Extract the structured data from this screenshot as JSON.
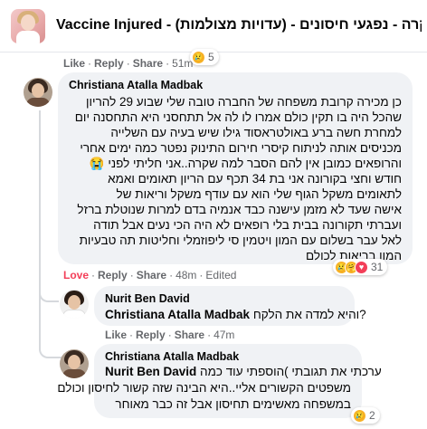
{
  "group": {
    "title": "Vaccine Injured - (עדויות מצולמות) - גם לנו זה קרה - נפגעי חיסונים"
  },
  "top_actions": {
    "like": "Like",
    "reply": "Reply",
    "share": "Share",
    "time": "51m",
    "reaction_count": "5"
  },
  "comments": [
    {
      "author": "Christiana Atalla Madbak",
      "lines": [
        "כן מכירה קרובת משפחה של החברה טובה שלי שבוע 29 להריון",
        "שהכל היה בו תקין כולם אמרו לו לה אל תתחסני היא התחסנה יום",
        "למחרת חשה ברע באולטראסוד גילו שיש בעיה עם השלייה",
        "מכניסים אותה לניתוח קיסרי חירום התינוק נפטר כמה ימים אחרי",
        "והרופאים כמובן אין להם הסבר למה שקרה..אני חליתי לפני 😭",
        "חודש וחצי בקורונה אני בת 34 תכף עם הריון תאומים ואמא",
        "לתאומים משקל הגוף שלי הוא עם עודף משקל וריאות של",
        "אישה שעד לא מזמן עישנה כבד אנמיה בדם למרות שנוטלת ברזל",
        "ועברתי תקורונה בבית בלי רופאים לא היה הכי נעים אבל תודה",
        "לאל עבר בשלום עם המון ויטמין סי ליפוזמלי וחליטות תה טבעיות",
        "המון בריאות לכולם"
      ],
      "actions": {
        "love": "Love",
        "reply": "Reply",
        "share": "Share",
        "time": "48m",
        "edited": "Edited"
      },
      "reaction_count": "31"
    },
    {
      "author": "Nurit Ben David",
      "tag": "Christiana Atalla Madbak",
      "text": "והיא למדה את הלקח?",
      "actions": {
        "like": "Like",
        "reply": "Reply",
        "share": "Share",
        "time": "47m"
      }
    },
    {
      "author": "Christiana Atalla Madbak",
      "tag": "Nurit Ben David",
      "first_line": "ערכתי את תגובתי )הוספתי עוד כמה",
      "lines": [
        "משפטים הקשורים אליי..היא הבינה שזה קשור לחיסון וכולם",
        "במשפחה מאשימים תחיסון אבל זה כבר מאוחר"
      ],
      "reaction_count": "2"
    }
  ],
  "icons": {
    "sad": "sad-emoji-icon",
    "care": "care-emoji-icon",
    "love": "heart-icon"
  }
}
